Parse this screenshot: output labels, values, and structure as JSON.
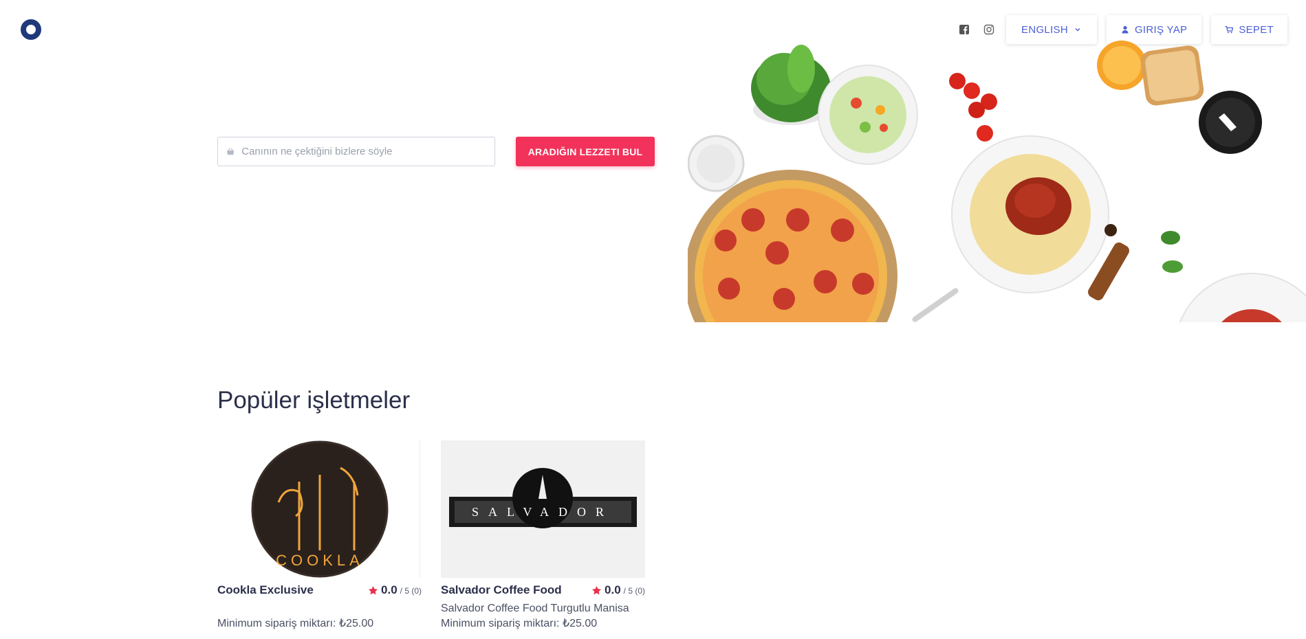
{
  "header": {
    "logo_icon": "brand-logo-icon",
    "social": [
      {
        "icon": "facebook-icon"
      },
      {
        "icon": "instagram-icon"
      }
    ],
    "language_label": "ENGLISH",
    "login_label": "GIRIŞ YAP",
    "cart_label": "SEPET"
  },
  "hero": {
    "search_placeholder": "Canının ne çektiğini bizlere söyle",
    "search_button": "ARADIĞIN LEZZETI BUL"
  },
  "popular": {
    "title": "Popüler işletmeler",
    "cards": [
      {
        "name": "Cookla Exclusive",
        "rating": "0.0",
        "rating_max": "/ 5 (0)",
        "description": "",
        "min_order": "Minimum sipariş miktarı: ₺25.00",
        "logo_text": "COOKLA"
      },
      {
        "name": "Salvador Coffee Food",
        "rating": "0.0",
        "rating_max": "/ 5 (0)",
        "description": "Salvador Coffee Food Turgutlu Manisa",
        "min_order": "Minimum sipariş miktarı: ₺25.00",
        "logo_text": "SALVADOR"
      }
    ]
  },
  "colors": {
    "accent": "#f2325a",
    "link": "#4b5fd6",
    "heading": "#2b2f4a",
    "star": "#e8304a"
  }
}
